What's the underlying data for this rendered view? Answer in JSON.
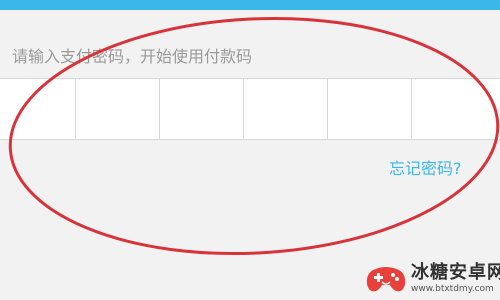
{
  "header": {
    "color": "#3cb7ea"
  },
  "payment": {
    "prompt": "请输入支付密码，开始使用付款码",
    "pin_cell_count": 6,
    "forgot_password": "忘记密码?"
  },
  "annotation": {
    "shape": "ellipse",
    "color": "#d9333a"
  },
  "watermark": {
    "name": "冰糖安卓网",
    "url": "www.btxtdmy.com",
    "logo_icon": "game-controller-icon"
  }
}
